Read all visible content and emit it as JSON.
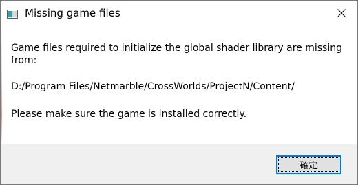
{
  "window": {
    "title": "Missing game files",
    "icon": "app-window-icon",
    "close_icon": "close-icon"
  },
  "message": {
    "line1": "Game files required to initialize the global shader library are missing from:",
    "path": "D:/Program Files/Netmarble/CrossWorlds/ProjectN/Content/",
    "line3": "Please make sure the game is installed correctly."
  },
  "footer": {
    "ok_label": "確定"
  },
  "colors": {
    "focus_border": "#0078d7",
    "button_bg": "#e1e1e1",
    "footer_bg": "#f0f0f0"
  }
}
